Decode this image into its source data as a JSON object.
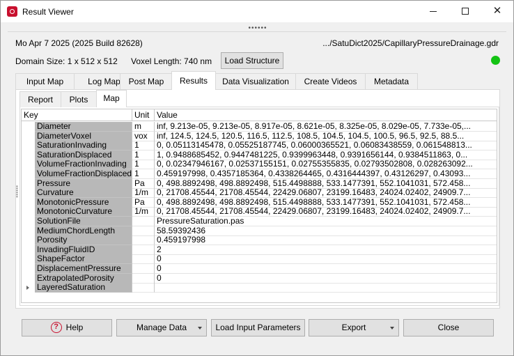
{
  "window": {
    "title": "Result Viewer",
    "minimize_icon": "minimize-icon",
    "maximize_icon": "maximize-icon",
    "close_icon": "close-icon"
  },
  "info": {
    "date": "Mo Apr 7 2025 (2025 Build 82628)",
    "path": ".../SatuDict2025/CapillaryPressureDrainage.gdr",
    "domain_size": "Domain Size: 1 x 512 x 512",
    "voxel_length": "Voxel Length: 740 nm",
    "load_structure": "Load Structure",
    "status_color": "#14c314"
  },
  "tabs": [
    "Input Map",
    "Log Map",
    "Post Map",
    "Results",
    "Data Visualization",
    "Create Videos",
    "Metadata"
  ],
  "active_tab": "Results",
  "subtabs": [
    "Report",
    "Plots",
    "Map"
  ],
  "active_subtab": "Map",
  "table": {
    "headers": {
      "key": "Key",
      "unit": "Unit",
      "value": "Value"
    },
    "rows": [
      {
        "key": "Diameter",
        "unit": "m",
        "value": "inf, 9.213e-05, 9.213e-05, 8.917e-05, 8.621e-05, 8.325e-05, 8.029e-05, 7.733e-05,..."
      },
      {
        "key": "DiameterVoxel",
        "unit": "vox",
        "value": "inf, 124.5, 124.5, 120.5, 116.5, 112.5, 108.5, 104.5, 104.5, 100.5, 96.5, 92.5, 88.5..."
      },
      {
        "key": "SaturationInvading",
        "unit": "1",
        "value": "0, 0.05113145478, 0.05525187745, 0.06000365521, 0.06083438559, 0.061548813..."
      },
      {
        "key": "SaturationDisplaced",
        "unit": "1",
        "value": "1, 0.9488685452, 0.9447481225, 0.9399963448, 0.9391656144, 0.9384511863, 0..."
      },
      {
        "key": "VolumeFractionInvading",
        "unit": "1",
        "value": "0, 0.02347946167, 0.02537155151, 0.02755355835, 0.02793502808, 0.028263092..."
      },
      {
        "key": "VolumeFractionDisplaced",
        "unit": "1",
        "value": "0.459197998, 0.4357185364, 0.4338264465, 0.4316444397, 0.43126297, 0.43093..."
      },
      {
        "key": "Pressure",
        "unit": "Pa",
        "value": "0, 498.8892498, 498.8892498, 515.4498888, 533.1477391, 552.1041031, 572.458..."
      },
      {
        "key": "Curvature",
        "unit": "1/m",
        "value": "0, 21708.45544, 21708.45544, 22429.06807, 23199.16483, 24024.02402, 24909.7..."
      },
      {
        "key": "MonotonicPressure",
        "unit": "Pa",
        "value": "0, 498.8892498, 498.8892498, 515.4498888, 533.1477391, 552.1041031, 572.458..."
      },
      {
        "key": "MonotonicCurvature",
        "unit": "1/m",
        "value": "0, 21708.45544, 21708.45544, 22429.06807, 23199.16483, 24024.02402, 24909.7..."
      },
      {
        "key": "SolutionFile",
        "unit": "",
        "value": "PressureSaturation.pas"
      },
      {
        "key": "MediumChordLength",
        "unit": "",
        "value": "58.59392436"
      },
      {
        "key": "Porosity",
        "unit": "",
        "value": "0.459197998"
      },
      {
        "key": "InvadingFluidID",
        "unit": "",
        "value": "2"
      },
      {
        "key": "ShapeFactor",
        "unit": "",
        "value": "0"
      },
      {
        "key": "DisplacementPressure",
        "unit": "",
        "value": "0"
      },
      {
        "key": "ExtrapolatedPorosity",
        "unit": "",
        "value": "0"
      },
      {
        "key": "LayeredSaturation",
        "unit": "",
        "value": ""
      }
    ]
  },
  "buttons": {
    "help": "Help",
    "manage_data": "Manage Data",
    "load_input": "Load Input Parameters",
    "export": "Export",
    "close": "Close"
  }
}
